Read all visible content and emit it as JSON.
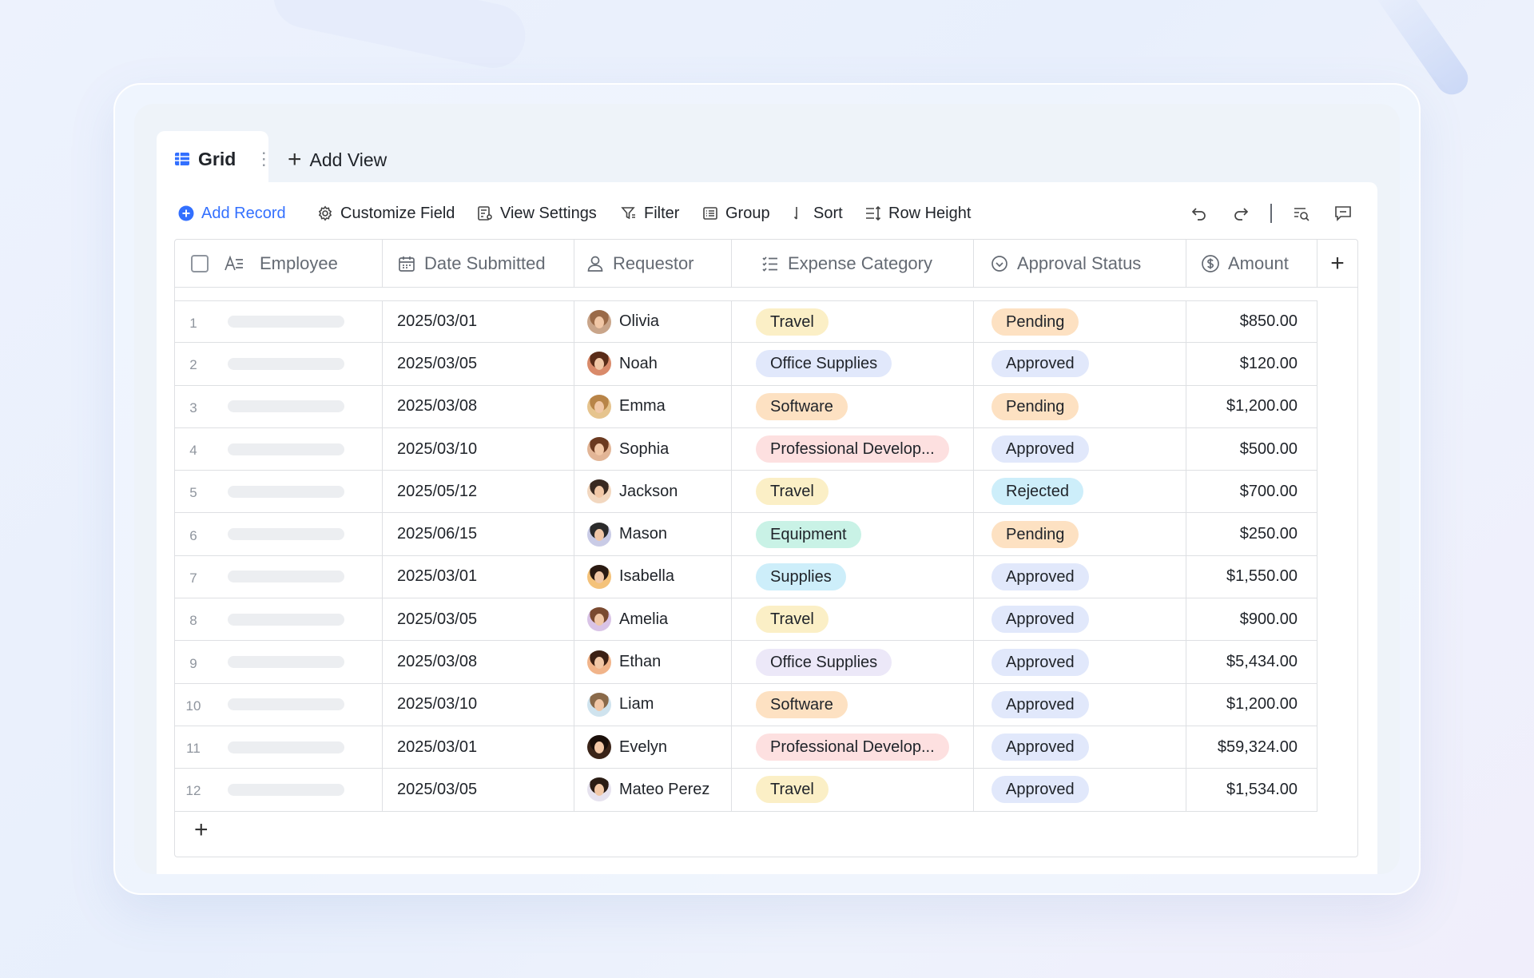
{
  "tabs": {
    "active_label": "Grid",
    "add_view_label": "Add View"
  },
  "toolbar": {
    "add_record": "Add Record",
    "customize_field": "Customize Field",
    "view_settings": "View Settings",
    "filter": "Filter",
    "group": "Group",
    "sort": "Sort",
    "row_height": "Row Height"
  },
  "columns": {
    "employee": "Employee",
    "date_submitted": "Date Submitted",
    "requestor": "Requestor",
    "expense_category": "Expense Category",
    "approval_status": "Approval Status",
    "amount": "Amount"
  },
  "colors": {
    "accent": "#3370ff",
    "category": {
      "Travel": "#fbefc6",
      "Office Supplies": "#e1e8fb",
      "Software": "#fde1c2",
      "Professional Develop...": "#fde0e0",
      "Equipment": "#c9f2e6",
      "Supplies": "#cdeefa"
    },
    "status": {
      "Pending": "#fde1c2",
      "Approved": "#e1e8fb",
      "Rejected": "#cdeefa"
    }
  },
  "rows": [
    {
      "num": "1",
      "date": "2025/03/01",
      "requestor": "Olivia",
      "avatar_bg": "#c9a58a",
      "hair": "#9a6a48",
      "category": "Travel",
      "cat_bg": "#fbefc6",
      "status": "Pending",
      "status_bg": "#fde1c2",
      "amount": "$850.00"
    },
    {
      "num": "2",
      "date": "2025/03/05",
      "requestor": "Noah",
      "avatar_bg": "#d98a6a",
      "hair": "#5a2c18",
      "category": "Office Supplies",
      "cat_bg": "#e1e8fb",
      "status": "Approved",
      "status_bg": "#e1e8fb",
      "amount": "$120.00"
    },
    {
      "num": "3",
      "date": "2025/03/08",
      "requestor": "Emma",
      "avatar_bg": "#e6c48e",
      "hair": "#b88448",
      "category": "Software",
      "cat_bg": "#fde1c2",
      "status": "Pending",
      "status_bg": "#fde1c2",
      "amount": "$1,200.00"
    },
    {
      "num": "4",
      "date": "2025/03/10",
      "requestor": "Sophia",
      "avatar_bg": "#e2b596",
      "hair": "#6b3a20",
      "category": "Professional Develop...",
      "cat_bg": "#fde0e0",
      "status": "Approved",
      "status_bg": "#e1e8fb",
      "amount": "$500.00"
    },
    {
      "num": "5",
      "date": "2025/05/12",
      "requestor": "Jackson",
      "avatar_bg": "#f2d7bf",
      "hair": "#3a2a22",
      "category": "Travel",
      "cat_bg": "#fbefc6",
      "status": "Rejected",
      "status_bg": "#cdeefa",
      "amount": "$700.00"
    },
    {
      "num": "6",
      "date": "2025/06/15",
      "requestor": "Mason",
      "avatar_bg": "#c9cbe6",
      "hair": "#2b2b2b",
      "category": "Equipment",
      "cat_bg": "#c9f2e6",
      "status": "Pending",
      "status_bg": "#fde1c2",
      "amount": "$250.00"
    },
    {
      "num": "7",
      "date": "2025/03/01",
      "requestor": "Isabella",
      "avatar_bg": "#f4c27a",
      "hair": "#2a1a12",
      "category": "Supplies",
      "cat_bg": "#cdeefa",
      "status": "Approved",
      "status_bg": "#e1e8fb",
      "amount": "$1,550.00"
    },
    {
      "num": "8",
      "date": "2025/03/05",
      "requestor": "Amelia",
      "avatar_bg": "#d9c3e6",
      "hair": "#7a4a30",
      "category": "Travel",
      "cat_bg": "#fbefc6",
      "status": "Approved",
      "status_bg": "#e1e8fb",
      "amount": "$900.00"
    },
    {
      "num": "9",
      "date": "2025/03/08",
      "requestor": "Ethan",
      "avatar_bg": "#f1b48a",
      "hair": "#3b2014",
      "category": "Office Supplies",
      "cat_bg": "#ece8f8",
      "status": "Approved",
      "status_bg": "#e1e8fb",
      "amount": "$5,434.00"
    },
    {
      "num": "10",
      "date": "2025/03/10",
      "requestor": "Liam",
      "avatar_bg": "#cfe3ee",
      "hair": "#8a6a4a",
      "category": "Software",
      "cat_bg": "#fde1c2",
      "status": "Approved",
      "status_bg": "#e1e8fb",
      "amount": "$1,200.00"
    },
    {
      "num": "11",
      "date": "2025/03/01",
      "requestor": "Evelyn",
      "avatar_bg": "#3a2418",
      "hair": "#1a0f0a",
      "category": "Professional Develop...",
      "cat_bg": "#fde0e0",
      "status": "Approved",
      "status_bg": "#e1e8fb",
      "amount": "$59,324.00"
    },
    {
      "num": "12",
      "date": "2025/03/05",
      "requestor": "Mateo Perez",
      "avatar_bg": "#e6e2ee",
      "hair": "#2a1c14",
      "category": "Travel",
      "cat_bg": "#fbefc6",
      "status": "Approved",
      "status_bg": "#e1e8fb",
      "amount": "$1,534.00"
    }
  ]
}
